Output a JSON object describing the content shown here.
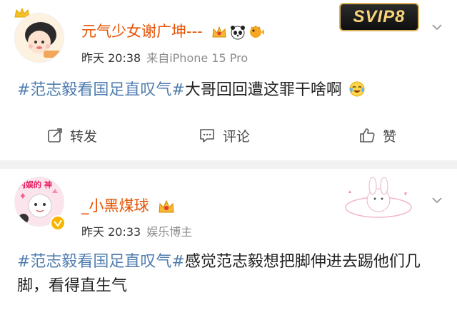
{
  "post1": {
    "username": "元气少女谢广坤---",
    "time": "昨天 20:38",
    "source": "来自iPhone 15 Pro",
    "vip_badge": "SVIP8",
    "topic": "#范志毅看国足直叹气#",
    "text": "大哥回回遭这罪干啥啊",
    "actions": {
      "repost": "转发",
      "comment": "评论",
      "like": "赞"
    }
  },
  "post2": {
    "username": "_小黑煤球",
    "time": "昨天 20:33",
    "source": "娱乐博主",
    "avatar_text": "内娱的 神",
    "topic": "#范志毅看国足直叹气#",
    "text": "感觉范志毅想把脚伸进去踢他们几脚，看得直生气"
  },
  "colors": {
    "link": "#507daf",
    "username": "#e65100",
    "divider": "#f2f2f2",
    "meta": "#8c8c8c"
  }
}
